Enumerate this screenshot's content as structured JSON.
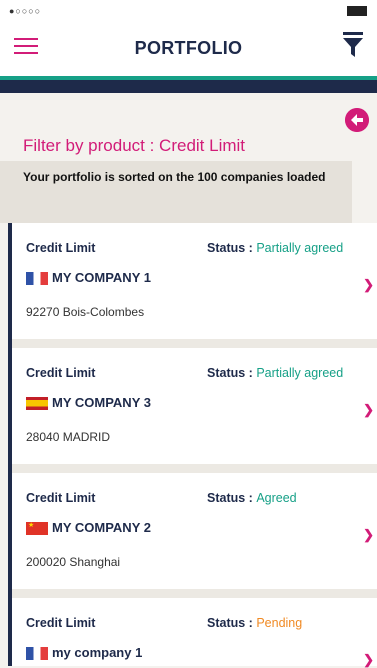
{
  "status_bar": {
    "signal_dots": "●○○○○"
  },
  "header": {
    "title": "PORTFOLIO"
  },
  "filter": {
    "title": "Filter by product : Credit Limit"
  },
  "sorted_note": "Your portfolio is sorted on the 100 companies loaded",
  "colors": {
    "brand": "#d21c78",
    "navy": "#1e2a4a",
    "green": "#16a087",
    "agreed": "#16a087",
    "pending": "#f08a24"
  },
  "cards": [
    {
      "product": "Credit Limit",
      "status_label": "Status :",
      "status_value": "Partially agreed",
      "status_color": "#16a087",
      "company": "MY COMPANY 1",
      "flag": "flag-fr",
      "city": "92270 Bois-Colombes"
    },
    {
      "product": "Credit Limit",
      "status_label": "Status :",
      "status_value": "Partially agreed",
      "status_color": "#16a087",
      "company": "MY COMPANY 3",
      "flag": "flag-es",
      "city": "28040 MADRID"
    },
    {
      "product": "Credit Limit",
      "status_label": "Status :",
      "status_value": "Agreed",
      "status_color": "#16a087",
      "company": "MY COMPANY 2",
      "flag": "flag-cn",
      "city": "200020 Shanghai"
    },
    {
      "product": "Credit Limit",
      "status_label": "Status :",
      "status_value": "Pending",
      "status_color": "#f08a24",
      "company": "my company 1",
      "flag": "flag-fr",
      "city": ""
    }
  ],
  "icons": {
    "menu": "hamburger-icon",
    "filter": "filter-funnel-icon",
    "back": "back-arrow-icon",
    "chevron": "chevron-right-icon"
  }
}
